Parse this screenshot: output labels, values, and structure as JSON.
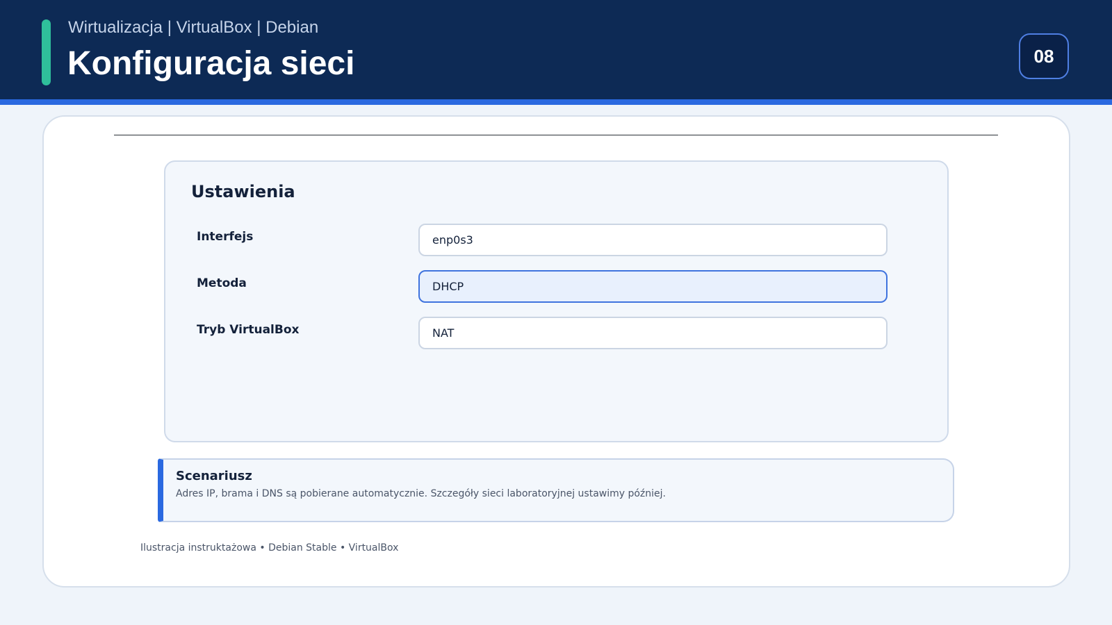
{
  "header": {
    "breadcrumb": "Wirtualizacja | VirtualBox | Debian",
    "title": "Konfiguracja sieci",
    "slide_number": "08"
  },
  "settings": {
    "title": "Ustawienia",
    "fields": [
      {
        "label": "Interfejs",
        "value": "enp0s3"
      },
      {
        "label": "Metoda",
        "value": "DHCP"
      },
      {
        "label": "Tryb VirtualBox",
        "value": "NAT"
      }
    ]
  },
  "scenario": {
    "title": "Scenariusz",
    "text": "Adres IP, brama i DNS są pobierane automatycznie. Szczegóły sieci laboratoryjnej ustawimy później."
  },
  "footer": {
    "note": "Ilustracja instruktażowa • Debian Stable • VirtualBox"
  },
  "colors": {
    "header_background": "#0d2a55",
    "accent_stripe": "#2a69e0",
    "accent_bar": "#2fbf9b",
    "focus_border": "#3f73de"
  }
}
